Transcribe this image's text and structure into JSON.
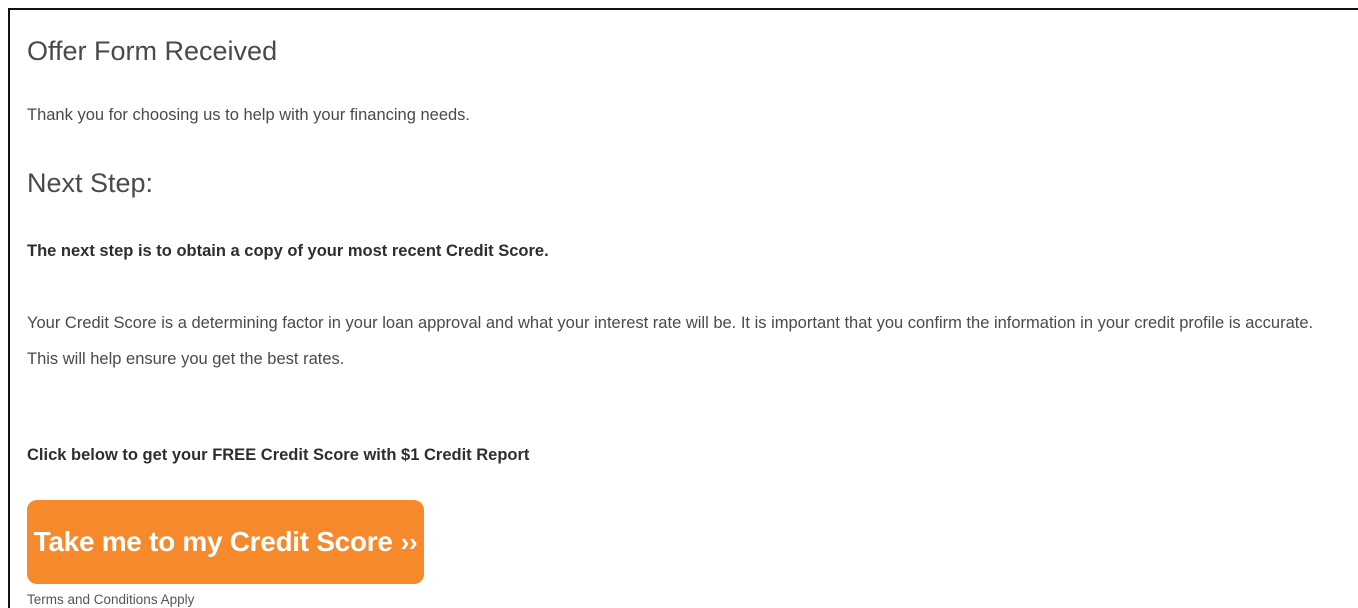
{
  "page": {
    "title": "Offer Form Received",
    "thank_you": "Thank you for choosing us to help with your financing needs.",
    "next_step_heading": "Next Step:",
    "next_step_bold": "The next step is to obtain a copy of your most recent Credit Score.",
    "explanation_line1": "Your Credit Score is a determining factor in your loan approval and what your interest rate will be. It is important that you confirm the information in your credit profile is accurate.",
    "explanation_line2": "This will help ensure you get the best rates.",
    "click_below": "Click below to get your FREE Credit Score with $1 Credit Report",
    "cta_label": "Take me to my Credit Score",
    "cta_chevron": "››",
    "terms": "Terms and Conditions Apply"
  },
  "colors": {
    "cta_background": "#f5892b",
    "cta_text": "#ffffff",
    "text": "#4a4a4a"
  }
}
